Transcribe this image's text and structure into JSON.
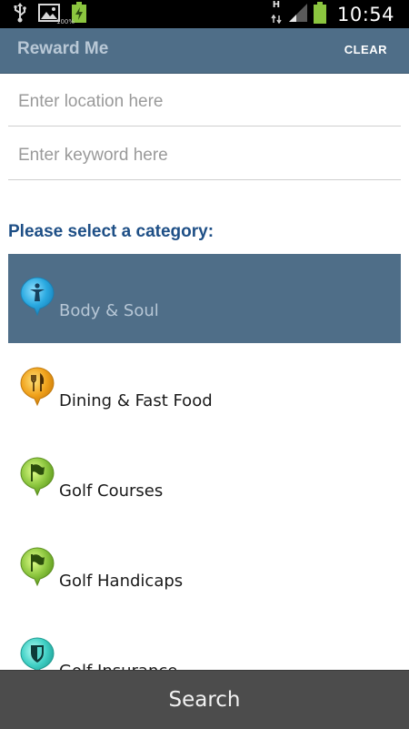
{
  "status_bar": {
    "time": "10:54",
    "network_type": "H",
    "battery_percent": "100%",
    "icons": [
      "usb-icon",
      "image-icon",
      "battery-charging-icon",
      "network-arrows-icon",
      "signal-icon",
      "battery-icon"
    ]
  },
  "action_bar": {
    "title": "Reward Me",
    "clear_label": "CLEAR"
  },
  "search": {
    "location_placeholder": "Enter location here",
    "location_value": "",
    "keyword_placeholder": "Enter keyword here",
    "keyword_value": ""
  },
  "category_heading": "Please select a category:",
  "categories": [
    {
      "label": "Body & Soul",
      "icon": "person-pin-icon",
      "color": "#2aa9e0",
      "selected": true
    },
    {
      "label": "Dining & Fast Food",
      "icon": "cutlery-pin-icon",
      "color": "#f0a21c",
      "selected": false
    },
    {
      "label": "Golf Courses",
      "icon": "golf-flag-pin-icon",
      "color": "#8cc63f",
      "selected": false
    },
    {
      "label": "Golf Handicaps",
      "icon": "golf-flag-pin-icon",
      "color": "#8cc63f",
      "selected": false
    },
    {
      "label": "Golf Insurance",
      "icon": "shield-pin-icon",
      "color": "#3fcfc4",
      "selected": false
    }
  ],
  "search_button_label": "Search",
  "colors": {
    "action_bar": "#4f6e88",
    "heading_text": "#1e4f86",
    "search_button": "#4c4c4c"
  }
}
